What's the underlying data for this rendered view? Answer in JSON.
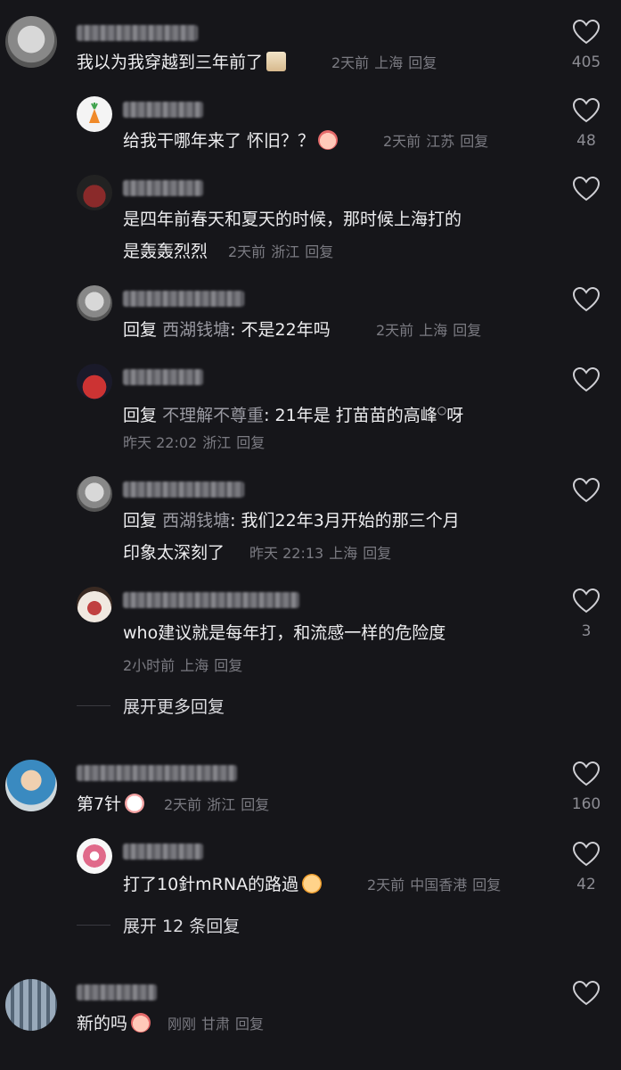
{
  "comments": [
    {
      "text": "我以为我穿越到三年前了",
      "time": "2天前",
      "location": "上海",
      "reply": "回复",
      "likes": "405",
      "replies": [
        {
          "text": "给我干哪年来了 怀旧？？",
          "time": "2天前",
          "location": "江苏",
          "reply": "回复",
          "likes": "48"
        },
        {
          "text_line1": "是四年前春天和夏天的时候，那时候上海打的",
          "text_line2": "是轰轰烈烈",
          "time": "2天前",
          "location": "浙江",
          "reply": "回复",
          "likes": ""
        },
        {
          "prefix": "回复",
          "mention": "西湖钱塘",
          "text": ": 不是22年吗",
          "time": "2天前",
          "location": "上海",
          "reply": "回复",
          "likes": ""
        },
        {
          "prefix": "回复",
          "mention": "不理解不尊重",
          "text": ": 21年是 打苗苗的高峰",
          "text_tail": "呀",
          "time": "昨天 22:02",
          "location": "浙江",
          "reply": "回复",
          "likes": ""
        },
        {
          "prefix": "回复",
          "mention": "西湖钱塘",
          "text": ": 我们22年3月开始的那三个月",
          "text_line2": "印象太深刻了",
          "time": "昨天 22:13",
          "location": "上海",
          "reply": "回复",
          "likes": ""
        },
        {
          "text": "who建议就是每年打，和流感一样的危险度",
          "time": "2小时前",
          "location": "上海",
          "reply": "回复",
          "likes": "3"
        }
      ],
      "expand_label": "展开更多回复"
    },
    {
      "text": "第7针",
      "time": "2天前",
      "location": "浙江",
      "reply": "回复",
      "likes": "160",
      "replies": [
        {
          "text": "打了10針mRNA的路過",
          "time": "2天前",
          "location": "中国香港",
          "reply": "回复",
          "likes": "42"
        }
      ],
      "expand_label": "展开 12 条回复"
    },
    {
      "text": "新的吗",
      "time": "刚刚",
      "location": "甘肃",
      "reply": "回复",
      "likes": ""
    }
  ],
  "colors": {
    "background": "#16161a",
    "text": "#eeeef0",
    "meta": "#7b7b82"
  }
}
